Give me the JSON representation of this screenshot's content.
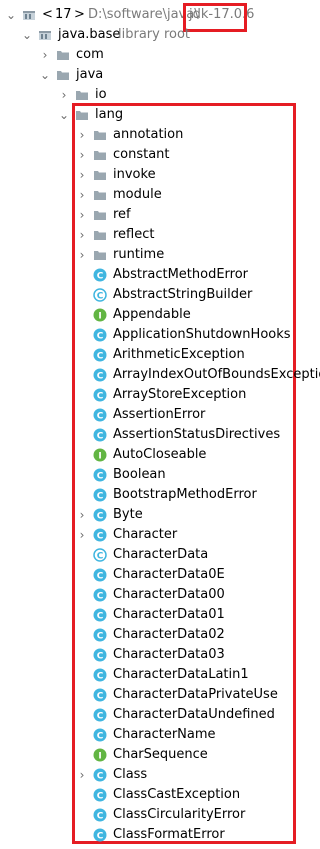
{
  "tree": {
    "sdk": {
      "chevron": "<",
      "name": "17",
      "chevron2": ">",
      "path": "D:\\software\\java\\",
      "version": "jdk-17.0.6"
    },
    "module": {
      "name": "java.base",
      "suffix": "library root"
    },
    "packages": [
      "com",
      "java",
      "io",
      "lang"
    ],
    "subpackages": [
      "annotation",
      "constant",
      "invoke",
      "module",
      "ref",
      "reflect",
      "runtime"
    ],
    "classes": [
      {
        "name": "AbstractMethodError",
        "kind": "class"
      },
      {
        "name": "AbstractStringBuilder",
        "kind": "abstract"
      },
      {
        "name": "Appendable",
        "kind": "interface"
      },
      {
        "name": "ApplicationShutdownHooks",
        "kind": "class"
      },
      {
        "name": "ArithmeticException",
        "kind": "class"
      },
      {
        "name": "ArrayIndexOutOfBoundsException",
        "kind": "class"
      },
      {
        "name": "ArrayStoreException",
        "kind": "class"
      },
      {
        "name": "AssertionError",
        "kind": "class"
      },
      {
        "name": "AssertionStatusDirectives",
        "kind": "class"
      },
      {
        "name": "AutoCloseable",
        "kind": "interface"
      },
      {
        "name": "Boolean",
        "kind": "class"
      },
      {
        "name": "BootstrapMethodError",
        "kind": "class"
      },
      {
        "name": "Byte",
        "kind": "class",
        "expandable": true
      },
      {
        "name": "Character",
        "kind": "class",
        "expandable": true
      },
      {
        "name": "CharacterData",
        "kind": "abstract"
      },
      {
        "name": "CharacterData0E",
        "kind": "class"
      },
      {
        "name": "CharacterData00",
        "kind": "class"
      },
      {
        "name": "CharacterData01",
        "kind": "class"
      },
      {
        "name": "CharacterData02",
        "kind": "class"
      },
      {
        "name": "CharacterData03",
        "kind": "class"
      },
      {
        "name": "CharacterDataLatin1",
        "kind": "class"
      },
      {
        "name": "CharacterDataPrivateUse",
        "kind": "class"
      },
      {
        "name": "CharacterDataUndefined",
        "kind": "class"
      },
      {
        "name": "CharacterName",
        "kind": "class"
      },
      {
        "name": "CharSequence",
        "kind": "interface"
      },
      {
        "name": "Class",
        "kind": "class",
        "expandable": true
      },
      {
        "name": "ClassCastException",
        "kind": "class"
      },
      {
        "name": "ClassCircularityError",
        "kind": "class"
      },
      {
        "name": "ClassFormatError",
        "kind": "class"
      }
    ]
  },
  "colors": {
    "folder": "#9aa7b0",
    "class_icon": "#40b6e0",
    "interface_icon": "#62b543",
    "highlight": "#e51c23",
    "muted_text": "#7a7a7a"
  }
}
